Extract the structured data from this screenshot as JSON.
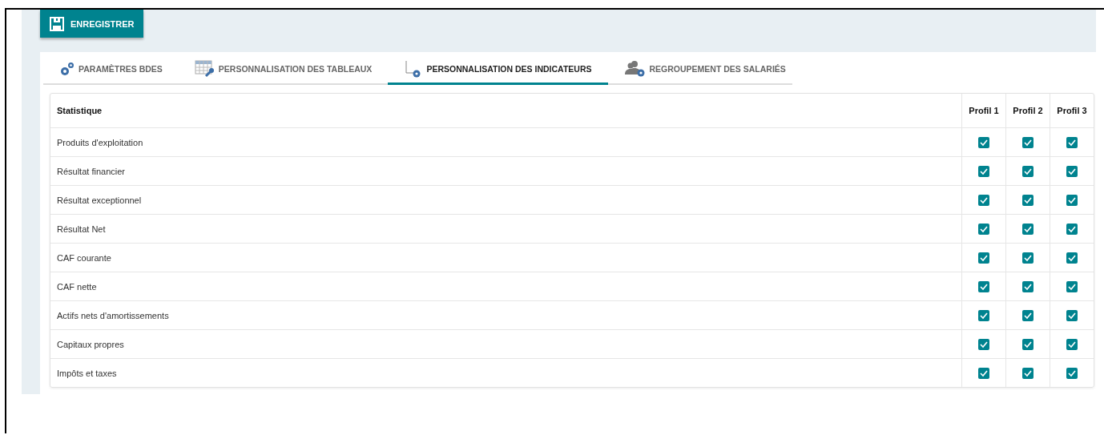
{
  "save_button": {
    "label": "ENREGISTRER"
  },
  "tabs": [
    {
      "label": "PARAMÈTRES BDES",
      "selected": false
    },
    {
      "label": "PERSONNALISATION DES TABLEAUX",
      "selected": false
    },
    {
      "label": "PERSONNALISATION DES INDICATEURS",
      "selected": true
    },
    {
      "label": "REGROUPEMENT DES SALARIÉS",
      "selected": false
    }
  ],
  "table": {
    "columns": [
      "Statistique",
      "Profil 1",
      "Profil 2",
      "Profil 3"
    ],
    "rows": [
      {
        "label": "Produits d'exploitation",
        "checked": [
          true,
          true,
          true
        ]
      },
      {
        "label": "Résultat financier",
        "checked": [
          true,
          true,
          true
        ]
      },
      {
        "label": "Résultat exceptionnel",
        "checked": [
          true,
          true,
          true
        ]
      },
      {
        "label": "Résultat Net",
        "checked": [
          true,
          true,
          true
        ]
      },
      {
        "label": "CAF courante",
        "checked": [
          true,
          true,
          true
        ]
      },
      {
        "label": "CAF nette",
        "checked": [
          true,
          true,
          true
        ]
      },
      {
        "label": "Actifs nets d'amortissements",
        "checked": [
          true,
          true,
          true
        ]
      },
      {
        "label": "Capitaux propres",
        "checked": [
          true,
          true,
          true
        ]
      },
      {
        "label": "Impôts et taxes",
        "checked": [
          true,
          true,
          true
        ]
      }
    ]
  }
}
